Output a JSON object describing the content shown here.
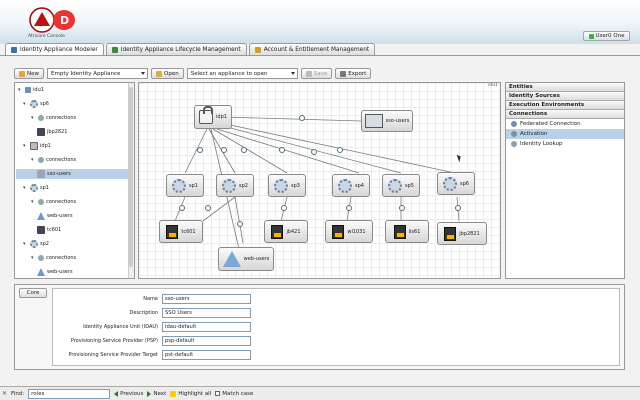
{
  "header": {
    "logo_text": "Atricore Console",
    "user_label": "User0 One"
  },
  "tabs": [
    {
      "label": "Identity Appliance Modeler",
      "color": "#3c6fb0"
    },
    {
      "label": "Identity Appliance Lifecycle Management",
      "color": "#3c8a3c"
    },
    {
      "label": "Account & Entitlement Management",
      "color": "#d0a020"
    }
  ],
  "toolbar": {
    "new_label": "New",
    "appliance_type": "Empty Identity Appliance",
    "open_label": "Open",
    "open_select": "Select an appliance to open",
    "save_label": "Save",
    "export_label": "Export"
  },
  "tree": {
    "root": "idu1",
    "items": [
      {
        "label": "idu1"
      },
      {
        "label": "sp6"
      },
      {
        "label": "connections"
      },
      {
        "label": "jbp2821"
      },
      {
        "label": "idp1"
      },
      {
        "label": "connections"
      },
      {
        "label": "sso-users"
      },
      {
        "label": "sp1"
      },
      {
        "label": "connections"
      },
      {
        "label": "web-users"
      },
      {
        "label": "tc601"
      },
      {
        "label": "sp2"
      },
      {
        "label": "connections"
      },
      {
        "label": "web-users"
      }
    ]
  },
  "canvas": {
    "tag": "idu1",
    "nodes": {
      "idp1": "idp1",
      "sso_users": "sso-users",
      "sp1": "sp1",
      "sp2": "sp2",
      "sp3": "sp3",
      "sp4": "sp4",
      "sp5": "sp5",
      "sp6": "sp6",
      "tc601": "tc601",
      "jb421": "jb421",
      "wl1031": "wl1031",
      "iis61": "iis61",
      "jbp2821": "jbp2821",
      "web_users": "web-users"
    }
  },
  "right_panel": {
    "sections": [
      "Entities",
      "Identity Sources",
      "Execution Environments",
      "Connections"
    ],
    "items": [
      {
        "label": "Federated Connection",
        "selected": false
      },
      {
        "label": "Activation",
        "selected": true
      },
      {
        "label": "Identity Lookup",
        "selected": false
      }
    ]
  },
  "properties": {
    "tab": "Core",
    "fields": [
      {
        "label": "Name",
        "value": "sso-users"
      },
      {
        "label": "Description",
        "value": "SSO Users"
      },
      {
        "label": "Identity Appliance Unit (IDAU)",
        "value": "idau-default"
      },
      {
        "label": "Provisioning Service Provider (PSP)",
        "value": "psp-default"
      },
      {
        "label": "Provisioning Service Provider Target",
        "value": "pst-default"
      }
    ]
  },
  "findbar": {
    "label": "Find:",
    "value": "roles",
    "previous": "Previous",
    "next": "Next",
    "highlight": "Highlight all",
    "match_case": "Match case"
  }
}
